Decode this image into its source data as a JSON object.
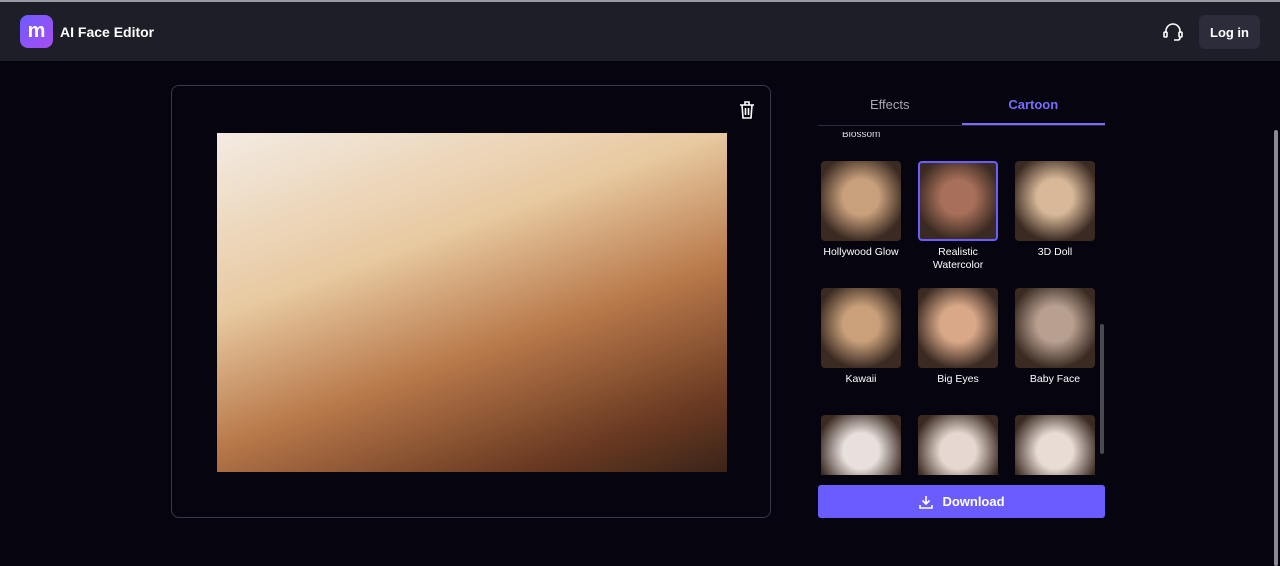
{
  "header": {
    "logo_text": "m",
    "title": "AI Face Editor",
    "login": "Log in"
  },
  "tabs": [
    {
      "label": "Effects"
    },
    {
      "label": "Cartoon",
      "active": true
    }
  ],
  "cut_label": "Blossom",
  "styles": [
    {
      "label": "Hollywood Glow",
      "color": "#c9a07c"
    },
    {
      "label": "Realistic Watercolor",
      "color": "#a8705a",
      "selected": true
    },
    {
      "label": "3D Doll",
      "color": "#d8b898"
    },
    {
      "label": "Kawaii",
      "color": "#c9a07a"
    },
    {
      "label": "Big Eyes",
      "color": "#d9a888"
    },
    {
      "label": "Baby Face",
      "color": "#b8a090"
    },
    {
      "label": "",
      "color": "#e8e0dc"
    },
    {
      "label": "",
      "color": "#e6d8d0"
    },
    {
      "label": "",
      "color": "#e8dcd4"
    }
  ],
  "download": "Download",
  "colors": {
    "accent": "#6b5cff",
    "header": "#1e1e28",
    "background": "#05040f"
  }
}
